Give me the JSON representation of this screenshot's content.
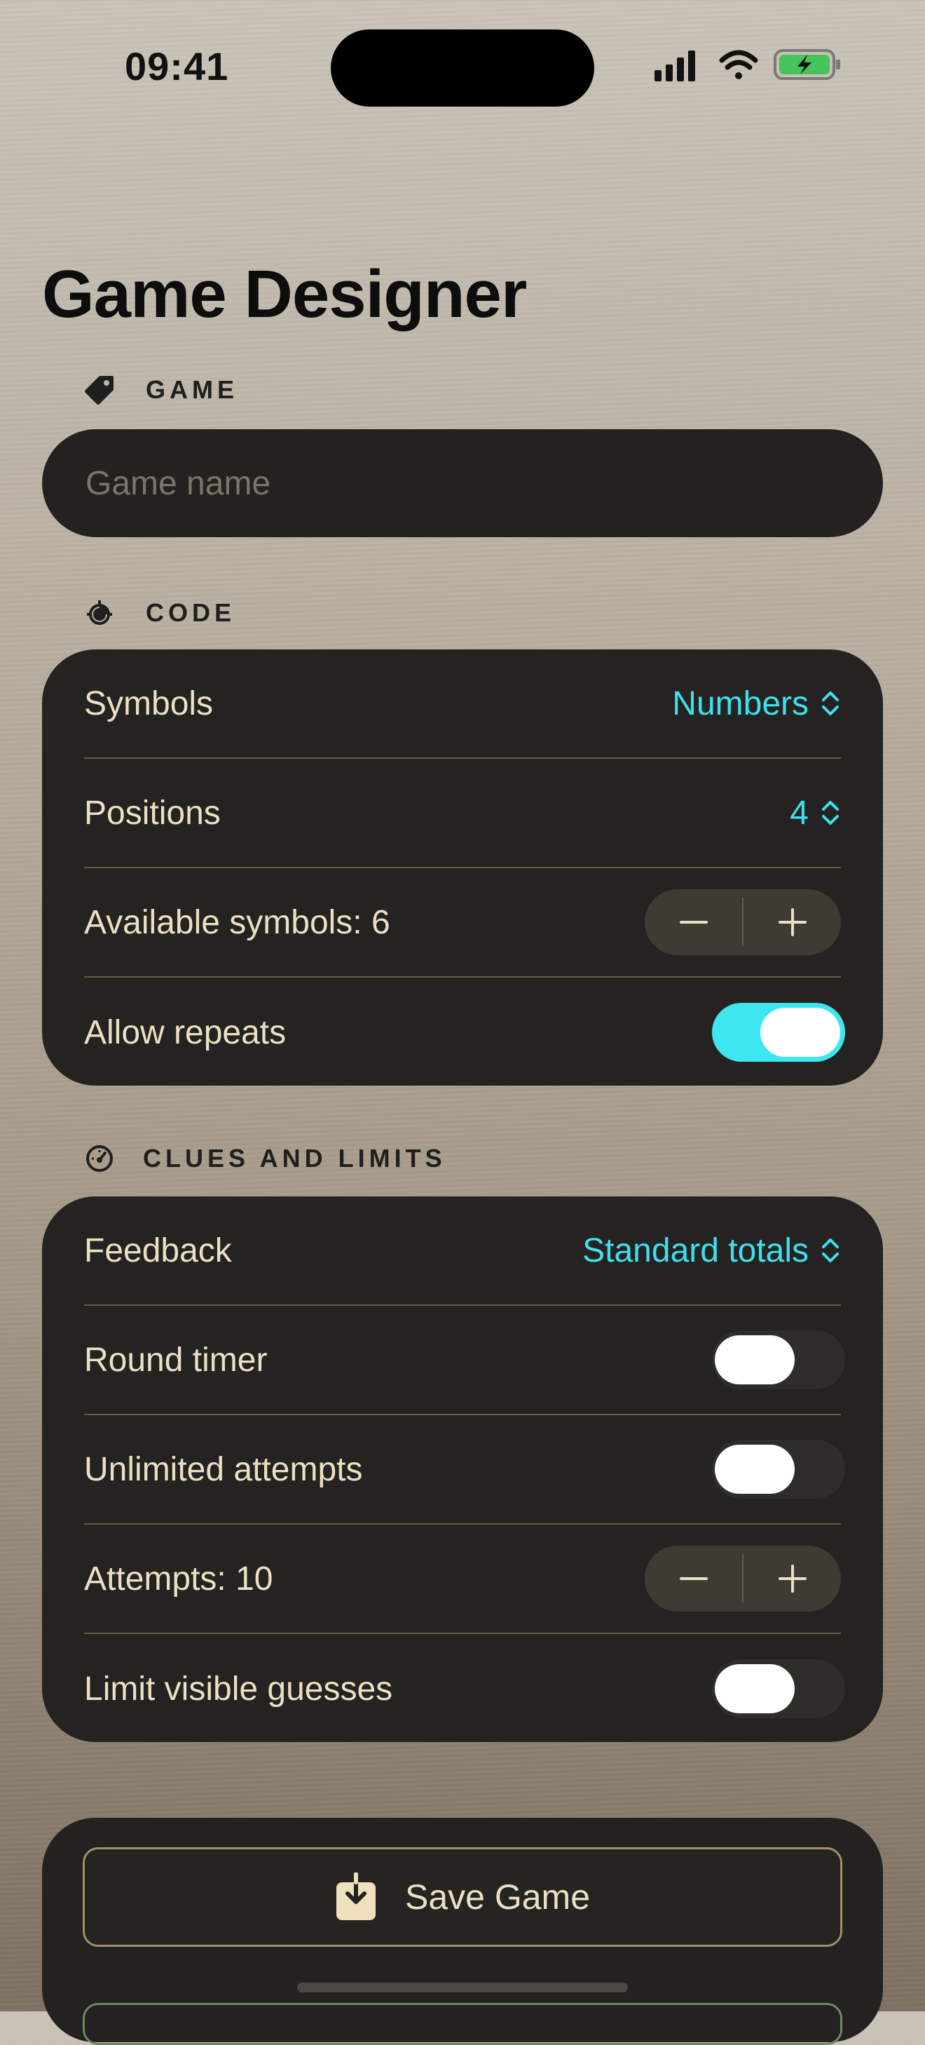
{
  "status_bar": {
    "time": "09:41"
  },
  "page": {
    "title": "Game Designer"
  },
  "sections": {
    "game": {
      "header": "GAME",
      "icon": "tag-icon",
      "name_placeholder": "Game name",
      "name_value": ""
    },
    "code": {
      "header": "CODE",
      "icon": "timer-icon",
      "rows": {
        "symbols": {
          "label": "Symbols",
          "value": "Numbers"
        },
        "positions": {
          "label": "Positions",
          "value": "4"
        },
        "available": {
          "label": "Available symbols: 6"
        },
        "repeats": {
          "label": "Allow repeats",
          "on": true
        }
      }
    },
    "clues": {
      "header": "CLUES AND LIMITS",
      "icon": "gauge-icon",
      "rows": {
        "feedback": {
          "label": "Feedback",
          "value": "Standard totals"
        },
        "timer": {
          "label": "Round timer",
          "on": false
        },
        "unlimited": {
          "label": "Unlimited attempts",
          "on": false
        },
        "attempts": {
          "label": "Attempts: 10"
        },
        "limit_visible": {
          "label": "Limit visible guesses",
          "on": false
        }
      }
    }
  },
  "actions": {
    "save_label": "Save Game"
  },
  "colors": {
    "accent": "#3ee0ee",
    "card": "#242321",
    "text": "#ece0c3",
    "separator": "#6b5a3e"
  }
}
